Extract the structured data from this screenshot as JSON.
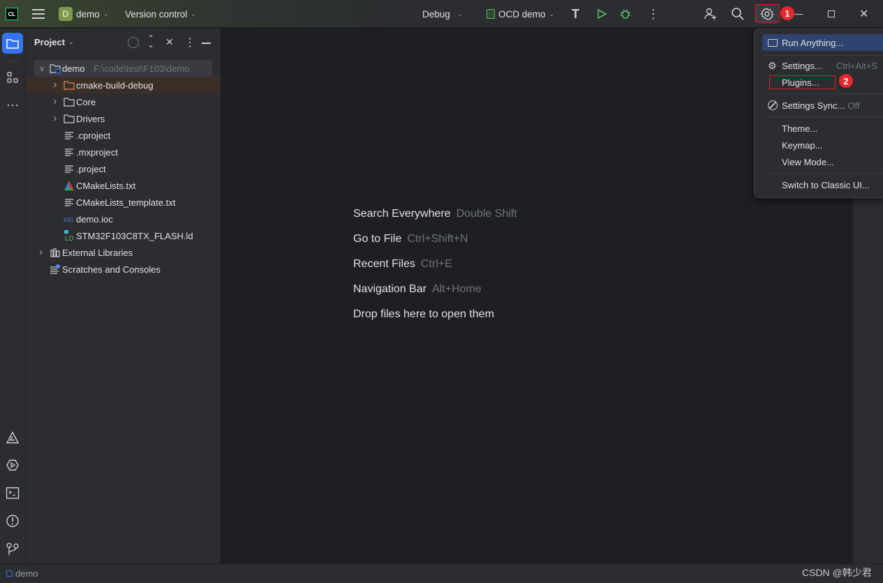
{
  "titlebar": {
    "app_logo": "CL",
    "project_initial": "D",
    "project": "demo",
    "vcs": "Version control",
    "run_config": "Debug",
    "target": "OCD demo"
  },
  "sidebar": {
    "title": "Project",
    "tree": [
      {
        "label": "demo",
        "path": "F:\\code\\test\\F103\\demo",
        "level": 0,
        "expandable": true,
        "expanded": true,
        "icon": "module-folder-icon"
      },
      {
        "label": "cmake-build-debug",
        "level": 1,
        "expandable": true,
        "icon": "excluded-folder-icon",
        "highlight": true
      },
      {
        "label": "Core",
        "level": 1,
        "expandable": true,
        "icon": "folder-icon"
      },
      {
        "label": "Drivers",
        "level": 1,
        "expandable": true,
        "icon": "folder-icon"
      },
      {
        "label": ".cproject",
        "level": 1,
        "icon": "text-file-icon"
      },
      {
        "label": ".mxproject",
        "level": 1,
        "icon": "text-file-icon"
      },
      {
        "label": ".project",
        "level": 1,
        "icon": "text-file-icon"
      },
      {
        "label": "CMakeLists.txt",
        "level": 1,
        "icon": "cmake-icon"
      },
      {
        "label": "CMakeLists_template.txt",
        "level": 1,
        "icon": "text-file-icon"
      },
      {
        "label": "demo.ioc",
        "level": 1,
        "icon": "ioc-file-icon"
      },
      {
        "label": "STM32F103C8TX_FLASH.ld",
        "level": 1,
        "icon": "ld-file-icon"
      },
      {
        "label": "External Libraries",
        "level": 0,
        "expandable": true,
        "icon": "library-icon"
      },
      {
        "label": "Scratches and Consoles",
        "level": 0,
        "icon": "scratches-icon"
      }
    ]
  },
  "editor": {
    "hints": [
      {
        "label": "Search Everywhere",
        "key": "Double Shift"
      },
      {
        "label": "Go to File",
        "key": "Ctrl+Shift+N"
      },
      {
        "label": "Recent Files",
        "key": "Ctrl+E"
      },
      {
        "label": "Navigation Bar",
        "key": "Alt+Home"
      },
      {
        "label": "Drop files here to open them",
        "key": ""
      }
    ]
  },
  "menu": {
    "items": {
      "run_anything": "Run Anything...",
      "settings": "Settings...",
      "settings_shortcut": "Ctrl+Alt+S",
      "plugins": "Plugins...",
      "settings_sync": "Settings Sync...",
      "settings_sync_state": "Off",
      "theme": "Theme...",
      "keymap": "Keymap...",
      "view_mode": "View Mode...",
      "classic_ui": "Switch to Classic UI..."
    }
  },
  "annotations": {
    "step1": "1",
    "step2": "2",
    "color": "#e02020"
  },
  "statusbar": {
    "project": "demo"
  },
  "watermark": "CSDN @韩少君",
  "colors": {
    "accent": "#3574f0",
    "run_green": "#5fb865",
    "menu_selection": "#2e436e"
  }
}
